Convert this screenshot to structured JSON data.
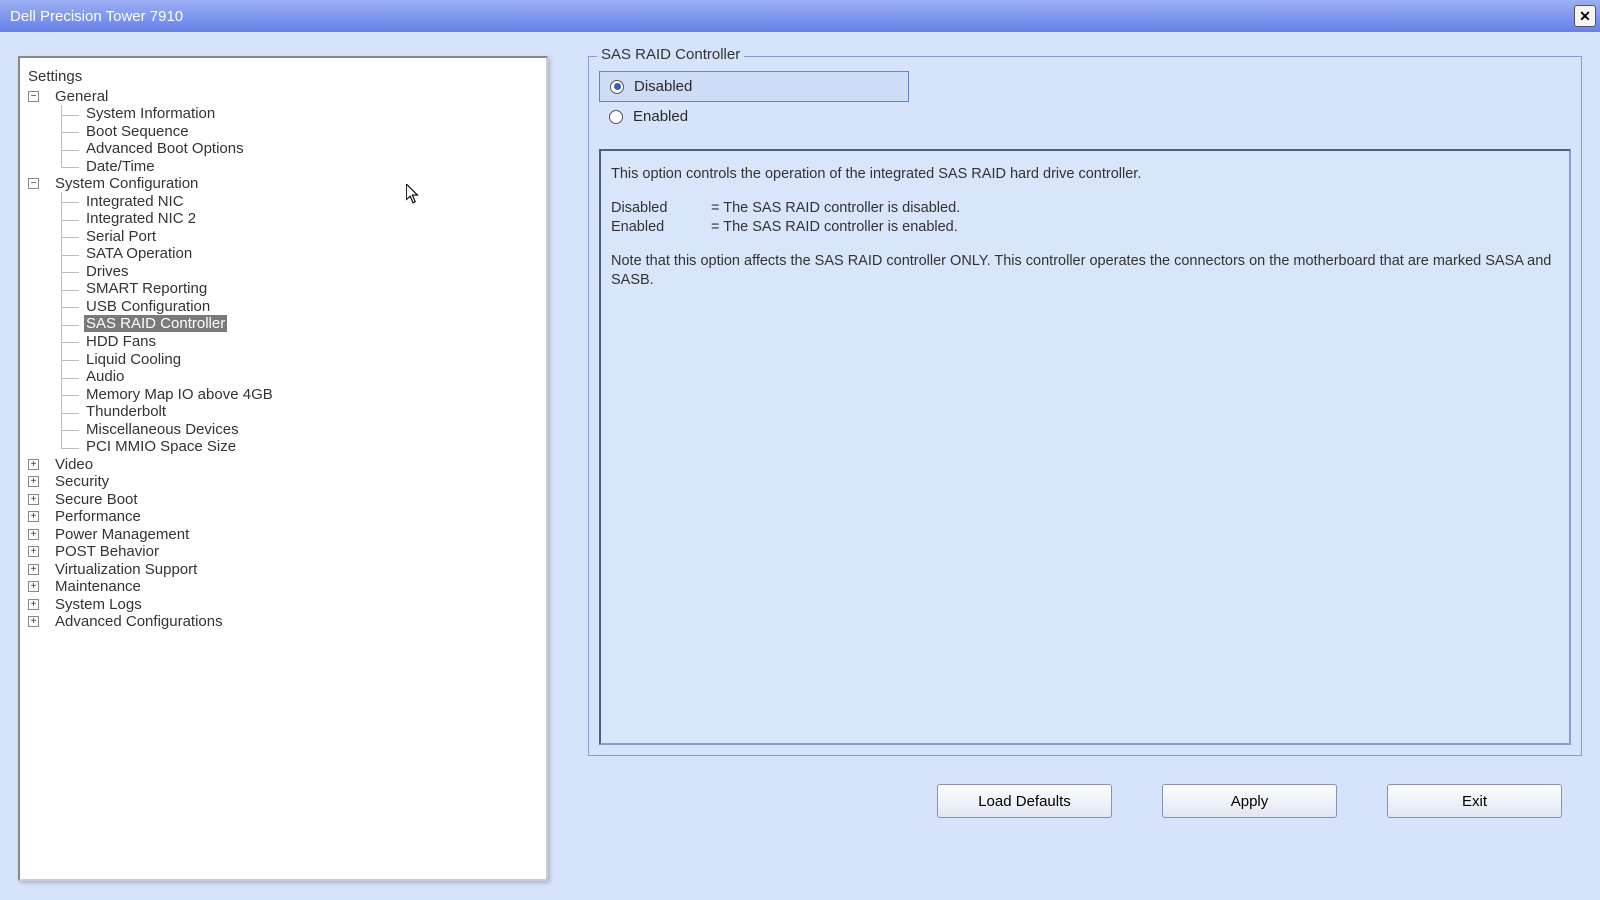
{
  "window": {
    "title": "Dell Precision Tower 7910",
    "close_label": "X"
  },
  "tree": {
    "root": "Settings",
    "groups": [
      {
        "label": "General",
        "expanded": true,
        "children": [
          "System Information",
          "Boot Sequence",
          "Advanced Boot Options",
          "Date/Time"
        ]
      },
      {
        "label": "System Configuration",
        "expanded": true,
        "children": [
          "Integrated NIC",
          "Integrated NIC 2",
          "Serial Port",
          "SATA Operation",
          "Drives",
          "SMART Reporting",
          "USB Configuration",
          "SAS RAID Controller",
          "HDD Fans",
          "Liquid Cooling",
          "Audio",
          "Memory Map IO above 4GB",
          "Thunderbolt",
          "Miscellaneous Devices",
          "PCI MMIO Space Size"
        ]
      },
      {
        "label": "Video",
        "expanded": false
      },
      {
        "label": "Security",
        "expanded": false
      },
      {
        "label": "Secure Boot",
        "expanded": false
      },
      {
        "label": "Performance",
        "expanded": false
      },
      {
        "label": "Power Management",
        "expanded": false
      },
      {
        "label": "POST Behavior",
        "expanded": false
      },
      {
        "label": "Virtualization Support",
        "expanded": false
      },
      {
        "label": "Maintenance",
        "expanded": false
      },
      {
        "label": "System Logs",
        "expanded": false
      },
      {
        "label": "Advanced Configurations",
        "expanded": false
      }
    ],
    "selected": "SAS RAID Controller"
  },
  "detail": {
    "legend": "SAS RAID Controller",
    "options": {
      "disabled": "Disabled",
      "enabled": "Enabled"
    },
    "selected_option": "disabled",
    "description": {
      "intro": "This option controls the operation of the integrated SAS RAID hard drive controller.",
      "rows": [
        {
          "key": "Disabled",
          "val": "= The SAS RAID controller is disabled."
        },
        {
          "key": "Enabled",
          "val": "= The SAS RAID controller is enabled."
        }
      ],
      "note": "Note that this option affects the SAS RAID controller ONLY.  This controller operates the connectors on the motherboard that are marked SASA and SASB."
    }
  },
  "buttons": {
    "load_defaults": "Load Defaults",
    "apply": "Apply",
    "exit": "Exit"
  }
}
